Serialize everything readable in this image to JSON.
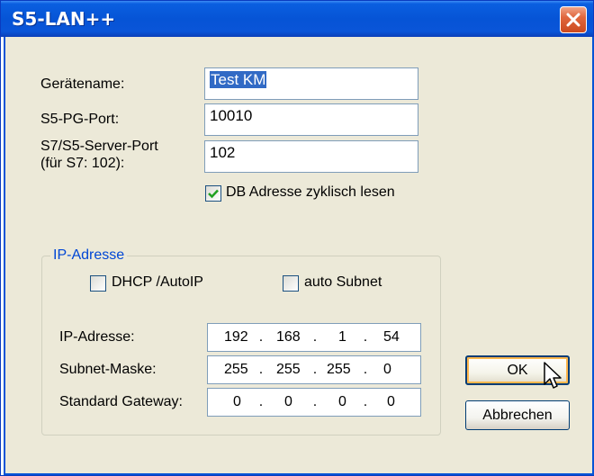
{
  "window": {
    "title": "S5-LAN++"
  },
  "form": {
    "device_name_label": "Gerätename:",
    "device_name_value": "Test KM",
    "pg_port_label": "S5-PG-Port:",
    "pg_port_value": "10010",
    "server_port_label_line1": "S7/S5-Server-Port",
    "server_port_label_line2": "(für S7: 102):",
    "server_port_value": "102",
    "db_cyclic_label": "DB Adresse zyklisch lesen",
    "db_cyclic_checked": true
  },
  "ip_group": {
    "title": "IP-Adresse",
    "dhcp_label": "DHCP /AutoIP",
    "dhcp_checked": false,
    "auto_subnet_label": "auto Subnet",
    "auto_subnet_checked": false,
    "ip_label": "IP-Adresse:",
    "ip": [
      "192",
      "168",
      "1",
      "54"
    ],
    "subnet_label": "Subnet-Maske:",
    "subnet": [
      "255",
      "255",
      "255",
      "0"
    ],
    "gateway_label": "Standard Gateway:",
    "gateway": [
      "0",
      "0",
      "0",
      "0"
    ]
  },
  "buttons": {
    "ok": "OK",
    "cancel": "Abbrechen"
  },
  "colors": {
    "titlebar": "#0654d6",
    "dialog_bg": "#ece9d8",
    "close": "#e0673e",
    "group_title": "#0046d5"
  }
}
